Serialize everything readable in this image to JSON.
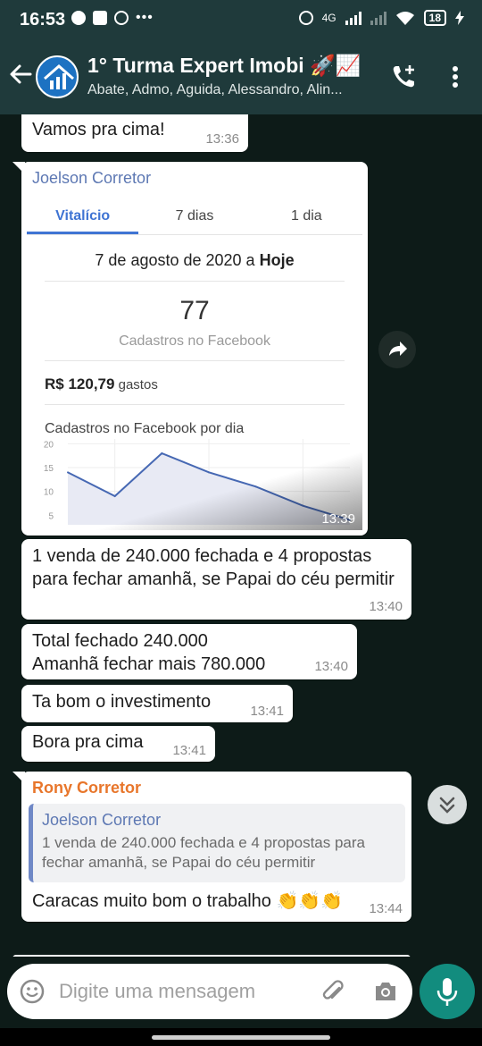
{
  "status_bar": {
    "time": "16:53",
    "network": "4G",
    "battery": "18"
  },
  "header": {
    "title": "1° Turma Expert Imobi 🚀📈",
    "subtitle": "Abate, Admo, Aguida, Alessandro, Alin..."
  },
  "messages": {
    "m1": {
      "text": "Vamos pra cima!",
      "time": "13:36"
    },
    "m2": {
      "sender": "Joelson Corretor",
      "time": "13:39",
      "card": {
        "tabs": [
          "Vitalício",
          "7 dias",
          "1 dia"
        ],
        "active_tab": "Vitalício",
        "date_range_start": "7 de agosto de 2020 a ",
        "date_range_end": "Hoje",
        "big_number": "77",
        "big_caption": "Cadastros no Facebook",
        "spent_amount": "R$ 120,79",
        "spent_label": " gastos",
        "chart_title": "Cadastros no Facebook por dia"
      }
    },
    "m3": {
      "text": "1 venda de 240.000 fechada e 4 propostas para fechar amanhã,  se Papai do céu permitir",
      "time": "13:40"
    },
    "m4": {
      "text_line1": "Total fechado 240.000",
      "text_line2": "Amanhã  fechar mais 780.000",
      "time": "13:40"
    },
    "m5": {
      "text": "Ta bom o investimento",
      "time": "13:41"
    },
    "m6": {
      "text": "Bora pra cima",
      "time": "13:41"
    },
    "m7": {
      "sender": "Rony Corretor",
      "quote_name": "Joelson Corretor",
      "quote_text": "1 venda de 240.000 fechada e 4 propostas para fechar amanhã,  se Papai do céu permitir",
      "text": "Caracas muito bom o trabalho 👏👏👏",
      "time": "13:44"
    }
  },
  "composer": {
    "placeholder": "Digite uma mensagem"
  },
  "colors": {
    "header_bg": "#1f3a3b",
    "chat_bg": "#0d1b18",
    "sender_joelson": "#5d78b3",
    "sender_rony": "#e8762b",
    "accent_tab": "#3f74d3",
    "mic_button": "#128c7e"
  },
  "chart_data": {
    "type": "area",
    "title": "Cadastros no Facebook por dia",
    "yticks": [
      5,
      10,
      15,
      20
    ],
    "ylim": [
      3,
      21
    ],
    "values": [
      14,
      9,
      18,
      14,
      11,
      7,
      4
    ],
    "grid": true
  }
}
